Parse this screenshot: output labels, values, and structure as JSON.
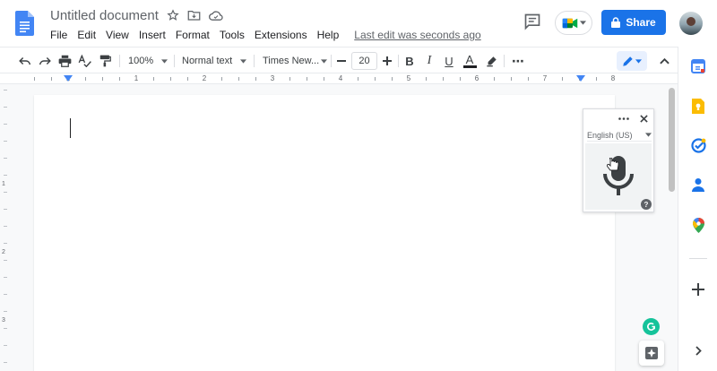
{
  "header": {
    "doc_title": "Untitled document",
    "menu": [
      "File",
      "Edit",
      "View",
      "Insert",
      "Format",
      "Tools",
      "Extensions",
      "Help"
    ],
    "last_edit": "Last edit was seconds ago",
    "share_label": "Share"
  },
  "toolbar": {
    "zoom": "100%",
    "style": "Normal text",
    "font": "Times New...",
    "font_size": "20",
    "bold": "B",
    "italic": "I",
    "underline": "U",
    "text_color_glyph": "A",
    "more": "⋯"
  },
  "ruler": {
    "numbers": [
      "1",
      "1",
      "2",
      "3",
      "4",
      "5",
      "6",
      "7",
      "8"
    ]
  },
  "vertical_ruler": {
    "numbers": [
      "1",
      "2",
      "3"
    ]
  },
  "voice_typing": {
    "language": "English (US)",
    "help": "?"
  },
  "colors": {
    "brand_blue": "#1a73e8",
    "docs_blue": "#4285f4",
    "grammarly_green": "#15c39a"
  },
  "icons": {
    "undo": "undo-icon",
    "redo": "redo-icon",
    "print": "print-icon",
    "spellcheck": "spellcheck-icon",
    "paint_format": "paint-format-icon",
    "star": "star-icon",
    "move": "folder-icon",
    "cloud": "cloud-status-icon",
    "comment": "comment-icon",
    "meet": "meet-icon",
    "lock": "lock-icon",
    "mic": "microphone-icon"
  }
}
